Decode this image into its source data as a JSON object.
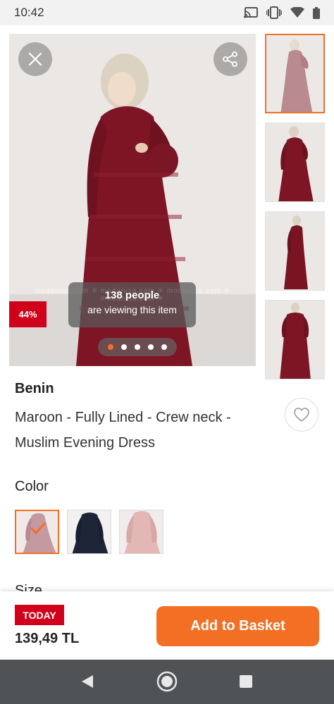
{
  "status_bar": {
    "time": "10:42",
    "icons": [
      "cast-icon",
      "vibrate-icon",
      "wifi-icon",
      "battery-icon"
    ]
  },
  "gallery": {
    "watermark": "modanisa.com  ✳  modanisa.com  ✳  modanisa.com  ✳  modanisa.com  ✳",
    "discount": "44%",
    "viewers_count": "138 people",
    "viewers_text": "are viewing this item",
    "image_count": 5,
    "active_image": 1,
    "thumbnail_count": 4
  },
  "product": {
    "brand": "Benin",
    "title": "Maroon - Fully Lined - Crew neck - Muslim Evening Dress"
  },
  "color": {
    "heading": "Color",
    "options": [
      "maroon",
      "navy",
      "powder-pink"
    ],
    "selected": "maroon"
  },
  "size": {
    "heading": "Size"
  },
  "bottom_bar": {
    "badge": "TODAY",
    "price": "139,49 TL",
    "add_to_basket": "Add to Basket"
  },
  "colors": {
    "accent": "#f36f24",
    "badge_red": "#d0021b",
    "maroon": "#7d1524"
  }
}
